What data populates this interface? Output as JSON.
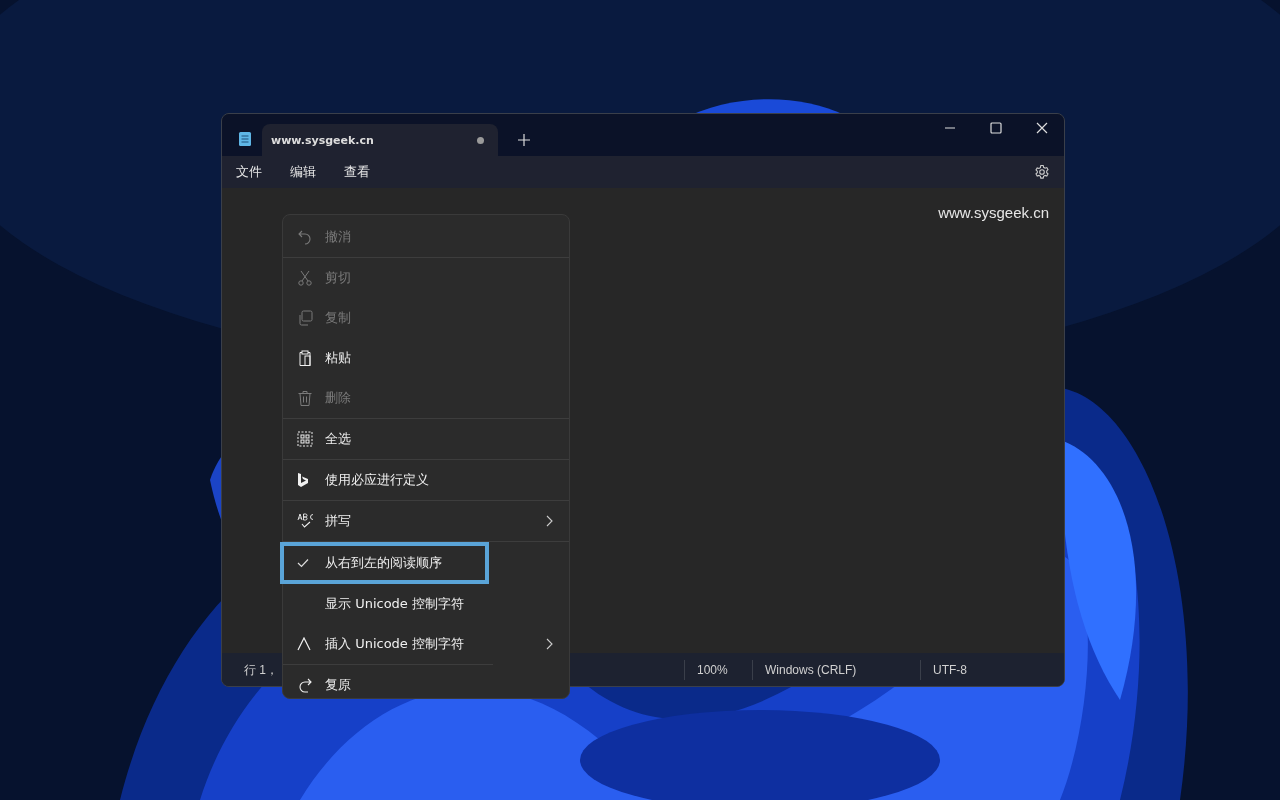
{
  "window": {
    "tab": {
      "title": "www.sysgeek.cn",
      "modified": true,
      "selected": true
    }
  },
  "menu_bar": [
    "文件",
    "编辑",
    "查看"
  ],
  "editor": {
    "text": "www.sysgeek.cn"
  },
  "context_menu": [
    {
      "kind": "item",
      "label": "撤消",
      "disabled": true,
      "submenu": false,
      "highlighted": false
    },
    {
      "kind": "separator"
    },
    {
      "kind": "item",
      "label": "剪切",
      "disabled": true,
      "submenu": false,
      "highlighted": false
    },
    {
      "kind": "item",
      "label": "复制",
      "disabled": true,
      "submenu": false,
      "highlighted": false
    },
    {
      "kind": "item",
      "label": "粘贴",
      "disabled": false,
      "submenu": false,
      "highlighted": false
    },
    {
      "kind": "item",
      "label": "删除",
      "disabled": true,
      "submenu": false,
      "highlighted": false
    },
    {
      "kind": "separator"
    },
    {
      "kind": "item",
      "label": "全选",
      "disabled": false,
      "submenu": false,
      "highlighted": false
    },
    {
      "kind": "separator"
    },
    {
      "kind": "item",
      "label": "使用必应进行定义",
      "disabled": false,
      "submenu": false,
      "highlighted": false
    },
    {
      "kind": "separator"
    },
    {
      "kind": "item",
      "label": "拼写",
      "disabled": false,
      "submenu": true,
      "highlighted": false
    },
    {
      "kind": "separator"
    },
    {
      "kind": "toggle",
      "label": "从右到左的阅读顺序",
      "checked": true,
      "highlighted": true
    },
    {
      "kind": "toggle",
      "label": "显示 Unicode 控制字符",
      "checked": false,
      "highlighted": false
    },
    {
      "kind": "item",
      "label": "插入 Unicode 控制字符",
      "disabled": false,
      "submenu": true,
      "highlighted": false
    },
    {
      "kind": "separator",
      "short": true
    },
    {
      "kind": "item",
      "label": "复原",
      "disabled": false,
      "submenu": false,
      "highlighted": false
    }
  ],
  "status_bar": [
    "行 1，",
    "100%",
    "Windows (CRLF)",
    "UTF-8"
  ]
}
